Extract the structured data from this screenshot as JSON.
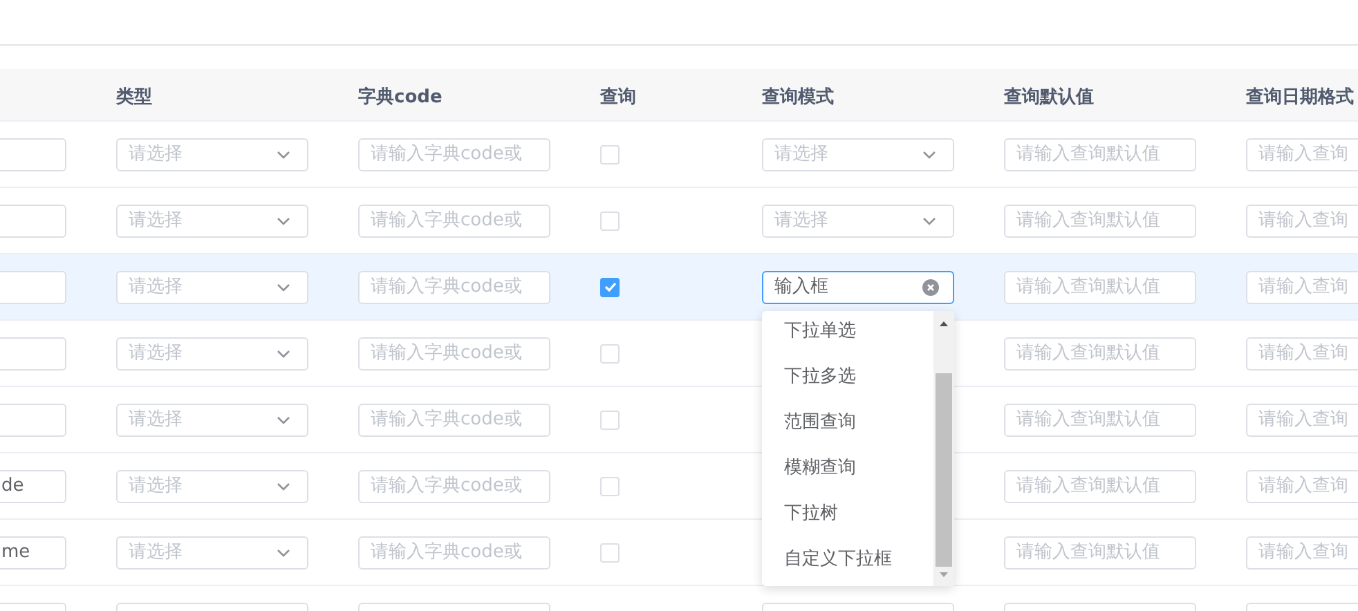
{
  "table": {
    "columns": [
      {
        "label": "类型"
      },
      {
        "label": "字典code"
      },
      {
        "label": "查询"
      },
      {
        "label": "查询模式"
      },
      {
        "label": "查询默认值"
      },
      {
        "label": "查询日期格式"
      }
    ],
    "rows": [
      {
        "selected": false,
        "type": {
          "placeholder": "请选择"
        },
        "dict": {
          "placeholder": "请输入字典code或"
        },
        "query": {
          "checked": false
        },
        "mode": {
          "placeholder": "请选择"
        },
        "default": {
          "placeholder": "请输入查询默认值"
        },
        "date": {
          "placeholder": "请输入查询"
        }
      },
      {
        "selected": false,
        "type": {
          "placeholder": "请选择"
        },
        "dict": {
          "placeholder": "请输入字典code或"
        },
        "query": {
          "checked": false
        },
        "mode": {
          "placeholder": "请选择"
        },
        "default": {
          "placeholder": "请输入查询默认值"
        },
        "date": {
          "placeholder": "请输入查询"
        }
      },
      {
        "selected": true,
        "type": {
          "placeholder": "请选择"
        },
        "dict": {
          "placeholder": "请输入字典code或"
        },
        "query": {
          "checked": true
        },
        "mode": {
          "value": "输入框",
          "focused": true,
          "options": [
            {
              "label": "下拉单选"
            },
            {
              "label": "下拉多选"
            },
            {
              "label": "范围查询"
            },
            {
              "label": "模糊查询"
            },
            {
              "label": "下拉树"
            },
            {
              "label": "自定义下拉框"
            }
          ]
        },
        "default": {
          "placeholder": "请输入查询默认值"
        },
        "date": {
          "placeholder": "请输入查询"
        }
      },
      {
        "selected": false,
        "type": {
          "placeholder": "请选择"
        },
        "dict": {
          "placeholder": "请输入字典code或"
        },
        "query": {
          "checked": false
        },
        "default": {
          "placeholder": "请输入查询默认值"
        },
        "date": {
          "placeholder": "请输入查询"
        }
      },
      {
        "selected": false,
        "type": {
          "placeholder": "请选择"
        },
        "dict": {
          "placeholder": "请输入字典code或"
        },
        "query": {
          "checked": false
        },
        "default": {
          "placeholder": "请输入查询默认值"
        },
        "date": {
          "placeholder": "请输入查询"
        }
      },
      {
        "selected": false,
        "name": {
          "value": "de"
        },
        "type": {
          "placeholder": "请选择"
        },
        "dict": {
          "placeholder": "请输入字典code或"
        },
        "query": {
          "checked": false
        },
        "default": {
          "placeholder": "请输入查询默认值"
        },
        "date": {
          "placeholder": "请输入查询"
        }
      },
      {
        "selected": false,
        "name": {
          "value": "me"
        },
        "type": {
          "placeholder": "请选择"
        },
        "dict": {
          "placeholder": "请输入字典code或"
        },
        "query": {
          "checked": false
        },
        "default": {
          "placeholder": "请输入查询默认值"
        },
        "date": {
          "placeholder": "请输入查询"
        }
      }
    ]
  }
}
